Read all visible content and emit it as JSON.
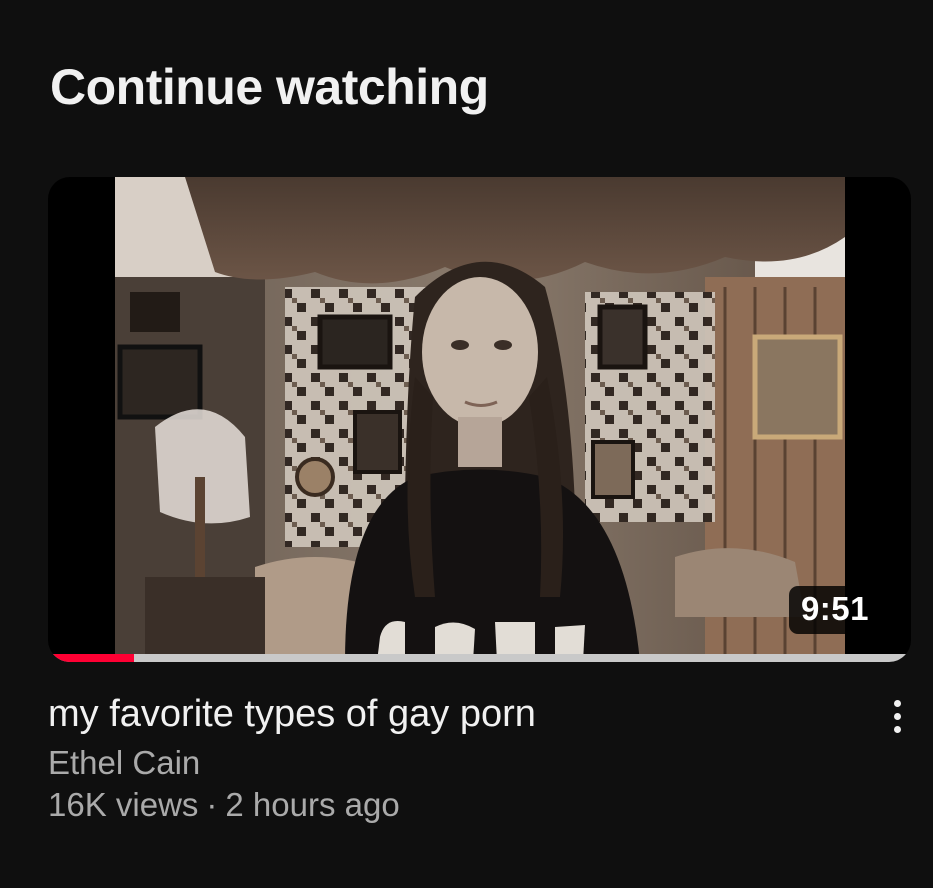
{
  "section": {
    "title": "Continue watching"
  },
  "video": {
    "title": "my favorite types of gay porn",
    "channel": "Ethel Cain",
    "views": "16K views",
    "separator": "·",
    "uploaded": "2 hours ago",
    "duration": "9:51",
    "watch_progress_fraction": 0.095,
    "more_icon": "more-vertical-icon"
  },
  "colors": {
    "background": "#0f0f0f",
    "progress": "#ff0033",
    "progress_track": "#c9c9c9",
    "secondary_text": "#aaaaaa"
  }
}
